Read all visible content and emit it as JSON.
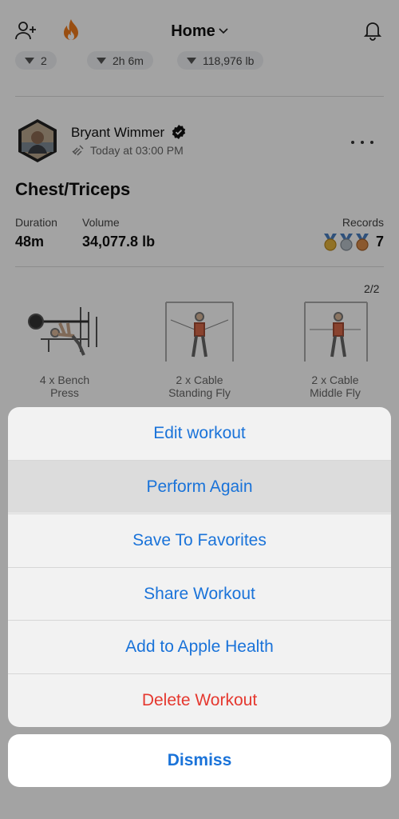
{
  "header": {
    "title": "Home",
    "add_friend_icon": "add-person-icon",
    "streak_icon": "flame-icon",
    "notifications_icon": "bell-icon"
  },
  "stats_strip": {
    "pills": [
      "2",
      "2h 6m",
      "118,976 lb"
    ]
  },
  "post": {
    "user_name": "Bryant Wimmer",
    "time": "Today at 03:00 PM",
    "title": "Chest/Triceps",
    "duration_label": "Duration",
    "duration_value": "48m",
    "volume_label": "Volume",
    "volume_value": "34,077.8 lb",
    "records_label": "Records",
    "records_value": "7",
    "page_indicator": "2/2",
    "exercises": [
      {
        "line1": "4 x Bench",
        "line2": "Press"
      },
      {
        "line1": "2 x Cable",
        "line2": "Standing Fly"
      },
      {
        "line1": "2 x Cable",
        "line2": "Middle Fly"
      }
    ]
  },
  "action_sheet": {
    "items": [
      {
        "label": "Edit workout"
      },
      {
        "label": "Perform Again"
      },
      {
        "label": "Save To Favorites"
      },
      {
        "label": "Share Workout"
      },
      {
        "label": "Add to Apple Health"
      },
      {
        "label": "Delete Workout"
      }
    ],
    "dismiss_label": "Dismiss"
  },
  "colors": {
    "accent": "#1a73d9",
    "destructive": "#e5382f",
    "streak": "#f07a1c"
  }
}
